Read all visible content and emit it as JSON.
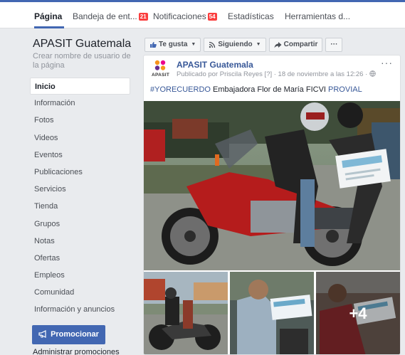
{
  "topbar": {
    "tabs": [
      {
        "label": "Página",
        "badge": ""
      },
      {
        "label": "Bandeja de ent...",
        "badge": "21"
      },
      {
        "label": "Notificaciones",
        "badge": "54"
      },
      {
        "label": "Estadísticas",
        "badge": ""
      },
      {
        "label": "Herramientas d...",
        "badge": ""
      }
    ]
  },
  "sidebar": {
    "page_name": "APASIT Guatemala",
    "username_prompt": "Crear nombre de usuario de la página",
    "items": [
      {
        "label": "Inicio"
      },
      {
        "label": "Información"
      },
      {
        "label": "Fotos"
      },
      {
        "label": "Videos"
      },
      {
        "label": "Eventos"
      },
      {
        "label": "Publicaciones"
      },
      {
        "label": "Servicios"
      },
      {
        "label": "Tienda"
      },
      {
        "label": "Grupos"
      },
      {
        "label": "Notas"
      },
      {
        "label": "Ofertas"
      },
      {
        "label": "Empleos"
      },
      {
        "label": "Comunidad"
      },
      {
        "label": "Información y anuncios"
      }
    ],
    "promote_label": "Promocionar",
    "admin_promos_label": "Administrar promociones"
  },
  "actions": {
    "like_label": "Te gusta",
    "following_label": "Siguiendo",
    "share_label": "Compartir",
    "more_label": "···"
  },
  "post": {
    "logo_text": "APASIT",
    "author": "APASIT Guatemala",
    "meta": "Publicado por Priscila Reyes [?] · 18 de noviembre a las 12:26 ·",
    "hashtag": "#YORECUERDO",
    "text_middle": " Embajadora Flor de María FICVI ",
    "mention": "PROVIAL",
    "more_photos": "+4",
    "more_icon": "···",
    "main_photo_card_text": "RECONOCIMIENTO",
    "thumb2_card_text": "RECONOCIMIENTO"
  },
  "colors": {
    "accent": "#4267b2",
    "link": "#385898",
    "badge": "#fa3e3e",
    "background": "#e9ebee"
  },
  "icons": [
    "thumbs-up-icon",
    "rss-icon",
    "share-arrow-icon",
    "megaphone-icon",
    "globe-icon",
    "more-dots-icon"
  ]
}
